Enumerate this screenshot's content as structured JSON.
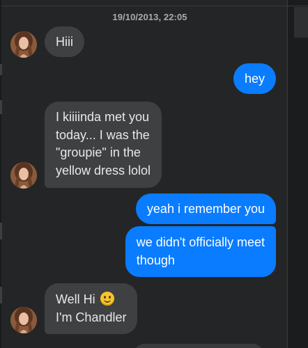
{
  "conversation": {
    "timestamp": "19/10/2013, 22:05",
    "messages": [
      {
        "sender": "contact",
        "lines": [
          "Hiii"
        ]
      },
      {
        "sender": "me",
        "lines": [
          "hey"
        ]
      },
      {
        "sender": "contact",
        "lines": [
          "I kiiiinda met you",
          "today... I was the",
          "\"groupie\" in the",
          "yellow dress lolol"
        ]
      },
      {
        "sender": "me",
        "lines": [
          "yeah i remember you"
        ]
      },
      {
        "sender": "me",
        "lines": [
          "we didn't officially meet",
          "though"
        ]
      },
      {
        "sender": "contact",
        "lines": [
          "Well Hi",
          "I'm Chandler"
        ],
        "emoji": "slightly-smiling-face-icon"
      }
    ]
  },
  "colors": {
    "background": "#242526",
    "incoming_bubble": "#3e4042",
    "outgoing_bubble": "#0a7cff",
    "timestamp_text": "#a8abaf"
  }
}
